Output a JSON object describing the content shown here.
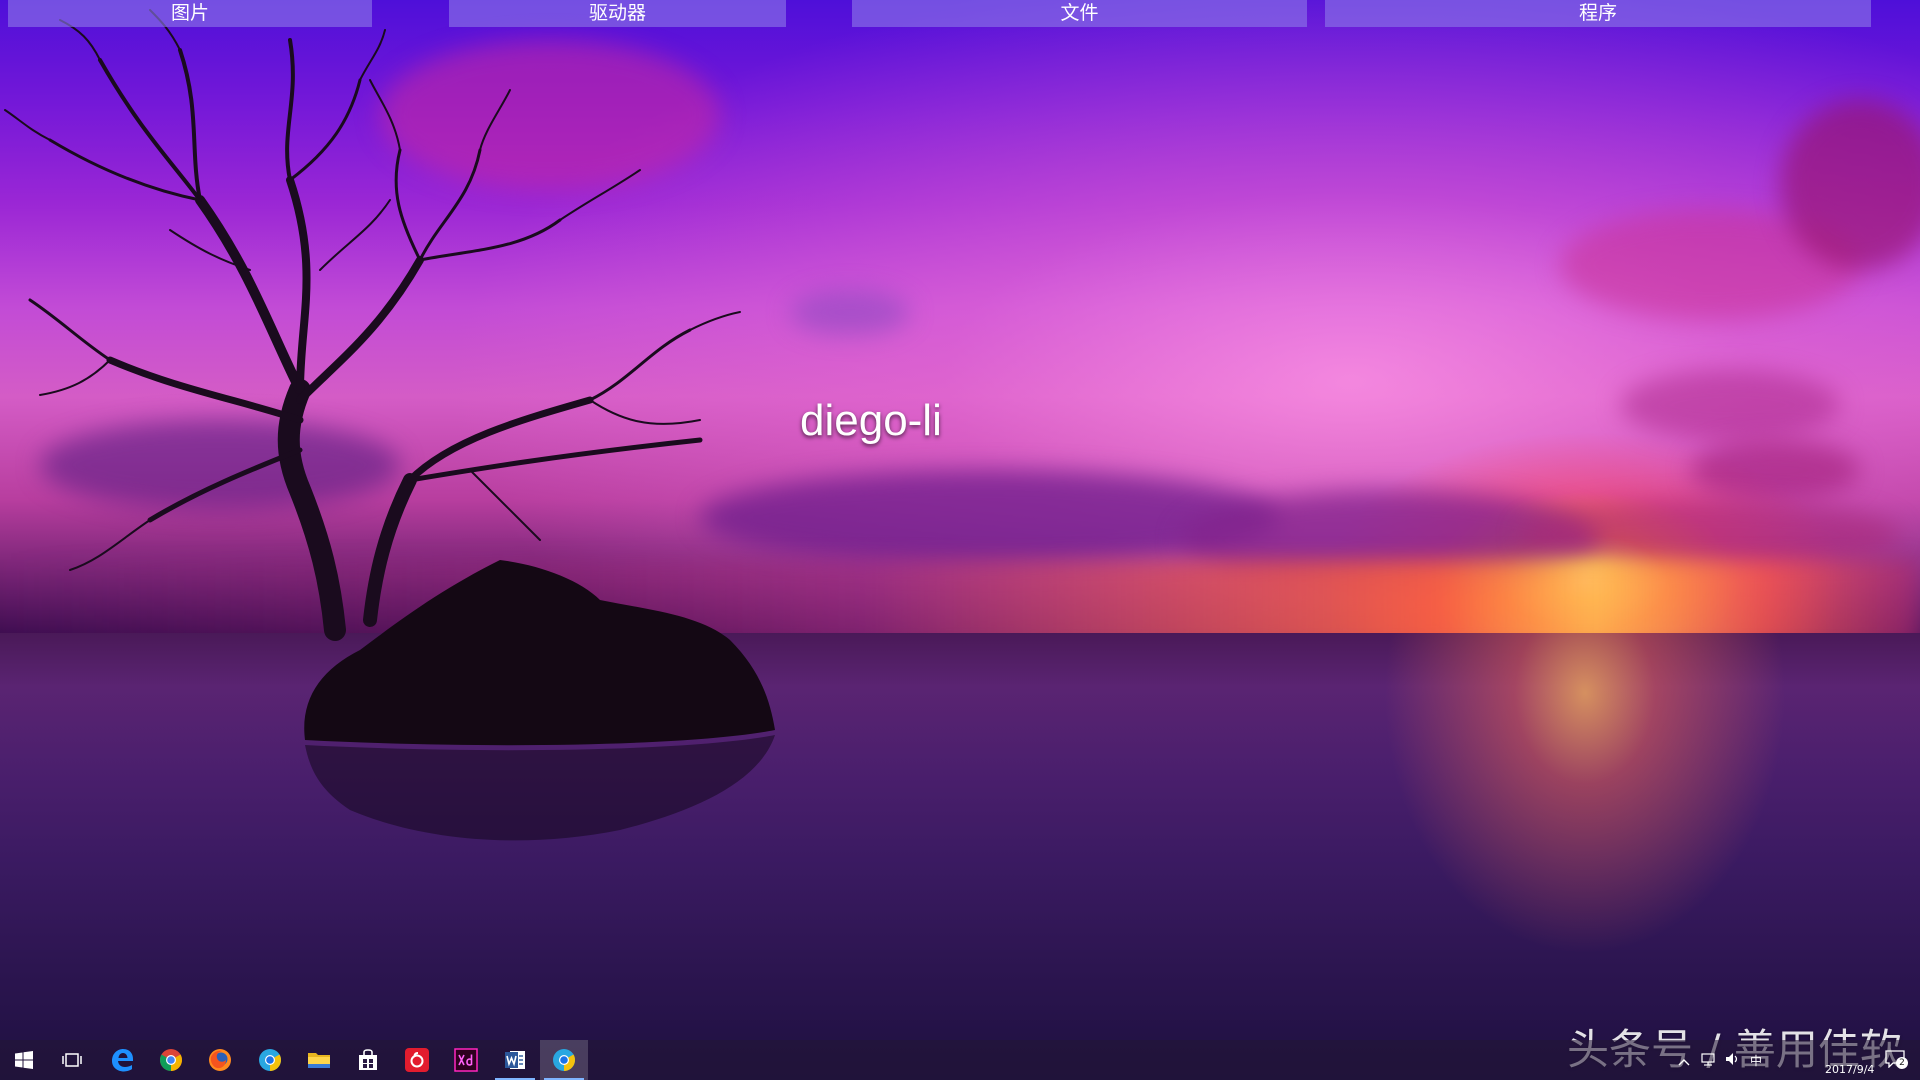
{
  "toolbar": {
    "buttons": [
      {
        "label": "图片"
      },
      {
        "label": "驱动器"
      },
      {
        "label": "文件"
      },
      {
        "label": "程序"
      }
    ]
  },
  "desktop": {
    "label": "diego-li"
  },
  "watermark": "头条号 / 善用佳软",
  "taskbar": {
    "items": [
      {
        "name": "start",
        "icon": "windows-logo-icon"
      },
      {
        "name": "task-view",
        "icon": "task-view-icon"
      },
      {
        "name": "edge",
        "icon": "edge-icon"
      },
      {
        "name": "chrome",
        "icon": "chrome-icon"
      },
      {
        "name": "firefox",
        "icon": "firefox-icon"
      },
      {
        "name": "chrome-canary",
        "icon": "chrome-blue-icon"
      },
      {
        "name": "file-explorer",
        "icon": "folder-icon"
      },
      {
        "name": "store",
        "icon": "store-icon"
      },
      {
        "name": "netease-music",
        "icon": "netease-music-icon"
      },
      {
        "name": "adobe-xd",
        "icon": "adobe-xd-icon"
      },
      {
        "name": "word",
        "icon": "word-icon"
      },
      {
        "name": "browser-active",
        "icon": "chrome-blue-icon"
      }
    ],
    "tray": {
      "ime": "中",
      "date": "2017/9/4",
      "notification_count": "2"
    }
  },
  "colors": {
    "toolbar_bg": "#8c78e6",
    "taskbar_bg": "#221634",
    "running_indicator": "#7fb4ff"
  }
}
